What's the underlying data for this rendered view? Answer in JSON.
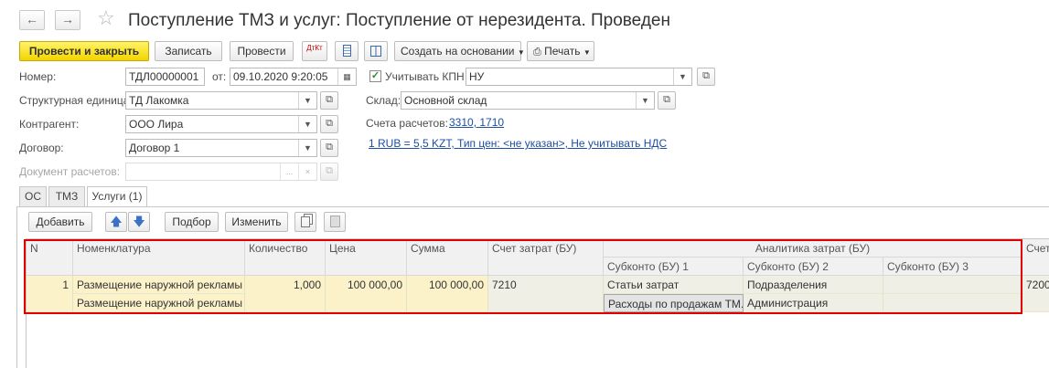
{
  "header": {
    "back_icon": "arrow-left-icon",
    "forward_icon": "arrow-right-icon",
    "title": "Поступление ТМЗ и услуг: Поступление от нерезидента. Проведен"
  },
  "toolbar": {
    "post_close": "Провести и закрыть",
    "save": "Записать",
    "post": "Провести",
    "dt_kt": "ДтКт",
    "create_based": "Создать на основании",
    "print": "Печать"
  },
  "form": {
    "number_label": "Номер:",
    "number_value": "ТДЛ00000001",
    "date_label": "от:",
    "date_value": "09.10.2020  9:20:05",
    "kpn_label": "Учитывать КПН",
    "kpn_checked": true,
    "kpn_value": "НУ",
    "unit_label": "Структурная единица:",
    "unit_value": "ТД Лакомка",
    "warehouse_label": "Склад:",
    "warehouse_value": "Основной склад",
    "contractor_label": "Контрагент:",
    "contractor_value": "ООО Лира",
    "accounts_label": "Счета расчетов:",
    "accounts_link": "3310, 1710",
    "contract_label": "Договор:",
    "contract_value": "Договор 1",
    "currency_link": "1 RUB = 5,5 KZT, Тип цен: <не указан>, Не учитывать НДС",
    "settlement_doc_label": "Документ расчетов:",
    "settlement_doc_value": ""
  },
  "tabs": [
    {
      "label": "ОС"
    },
    {
      "label": "ТМЗ"
    },
    {
      "label": "Услуги (1)"
    }
  ],
  "table_toolbar": {
    "add": "Добавить",
    "pick": "Подбор",
    "change": "Изменить"
  },
  "table": {
    "headers": {
      "n": "N",
      "nomenclature": "Номенклатура",
      "qty": "Количество",
      "price": "Цена",
      "sum": "Сумма",
      "cost_account": "Счет затрат (БУ)",
      "analytics": "Аналитика затрат (БУ)",
      "sub1": "Субконто (БУ) 1",
      "sub2": "Субконто (БУ) 2",
      "sub3": "Субконто (БУ) 3",
      "account_cut": "Счет"
    },
    "rows": [
      {
        "n": "1",
        "nomenclature": "Размещение наружной рекламы",
        "nomenclature2": "Размещение наружной рекламы",
        "qty": "1,000",
        "price": "100 000,00",
        "sum": "100 000,00",
        "cost_account": "7210",
        "sub1_type": "Статьи затрат",
        "sub1_value": "Расходы по продажам ТМ...",
        "sub2_type": "Подразделения",
        "sub2_value": "Администрация",
        "sub3_type": "",
        "sub3_value": "",
        "account_cut": "7200"
      }
    ]
  },
  "colors": {
    "primary_button": "#f3d400",
    "highlight_border": "#e00000",
    "link": "#1d4fa3",
    "row_yellow": "#fbf2c9"
  }
}
